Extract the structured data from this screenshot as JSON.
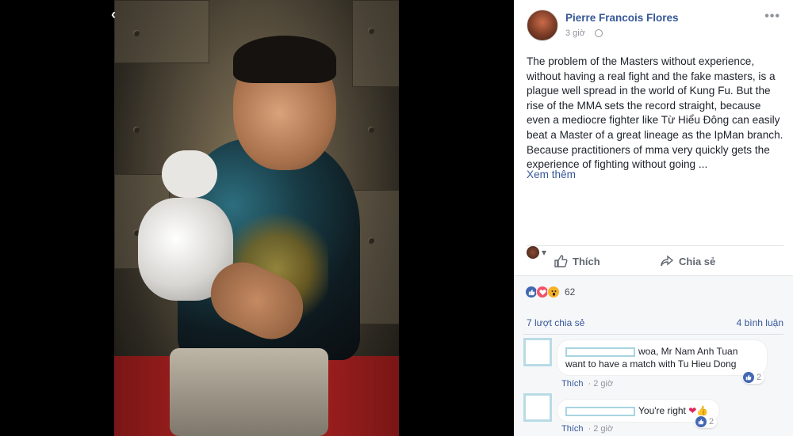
{
  "post": {
    "author": "Pierre Francois Flores",
    "time": "3 giờ",
    "more": "•••",
    "text": "The problem of the Masters without experience, without having a real fight and the fake masters, is a plague well spread in the world of Kung Fu. But the rise of the MMA sets the record straight, because even a mediocre fighter like Từ Hiểu Đông can easily beat a Master of a great lineage as the IpMan branch. Because practitioners of mma very quickly gets the experience of fighting without going ...",
    "see_more": "Xem thêm"
  },
  "actions": {
    "like": "Thích",
    "share": "Chia sẻ",
    "audience_caret": "▾"
  },
  "reactions": {
    "count": "62",
    "shares": "7 lượt chia sẻ",
    "comments": "4 bình luận"
  },
  "comments": [
    {
      "text": "woa, Mr Nam Anh Tuan want to have a match with Tu Hieu Dong",
      "like": "Thích",
      "time": "2 giờ",
      "reactions": "2"
    },
    {
      "text": "You're right",
      "emoji": "❤👍",
      "like": "Thích",
      "time": "2 giờ",
      "reactions": "2"
    }
  ],
  "photo": {
    "back": "‹"
  },
  "colors": {
    "link": "#365899",
    "accent": "#4267b2",
    "text": "#1d2129",
    "muted": "#90949c"
  }
}
